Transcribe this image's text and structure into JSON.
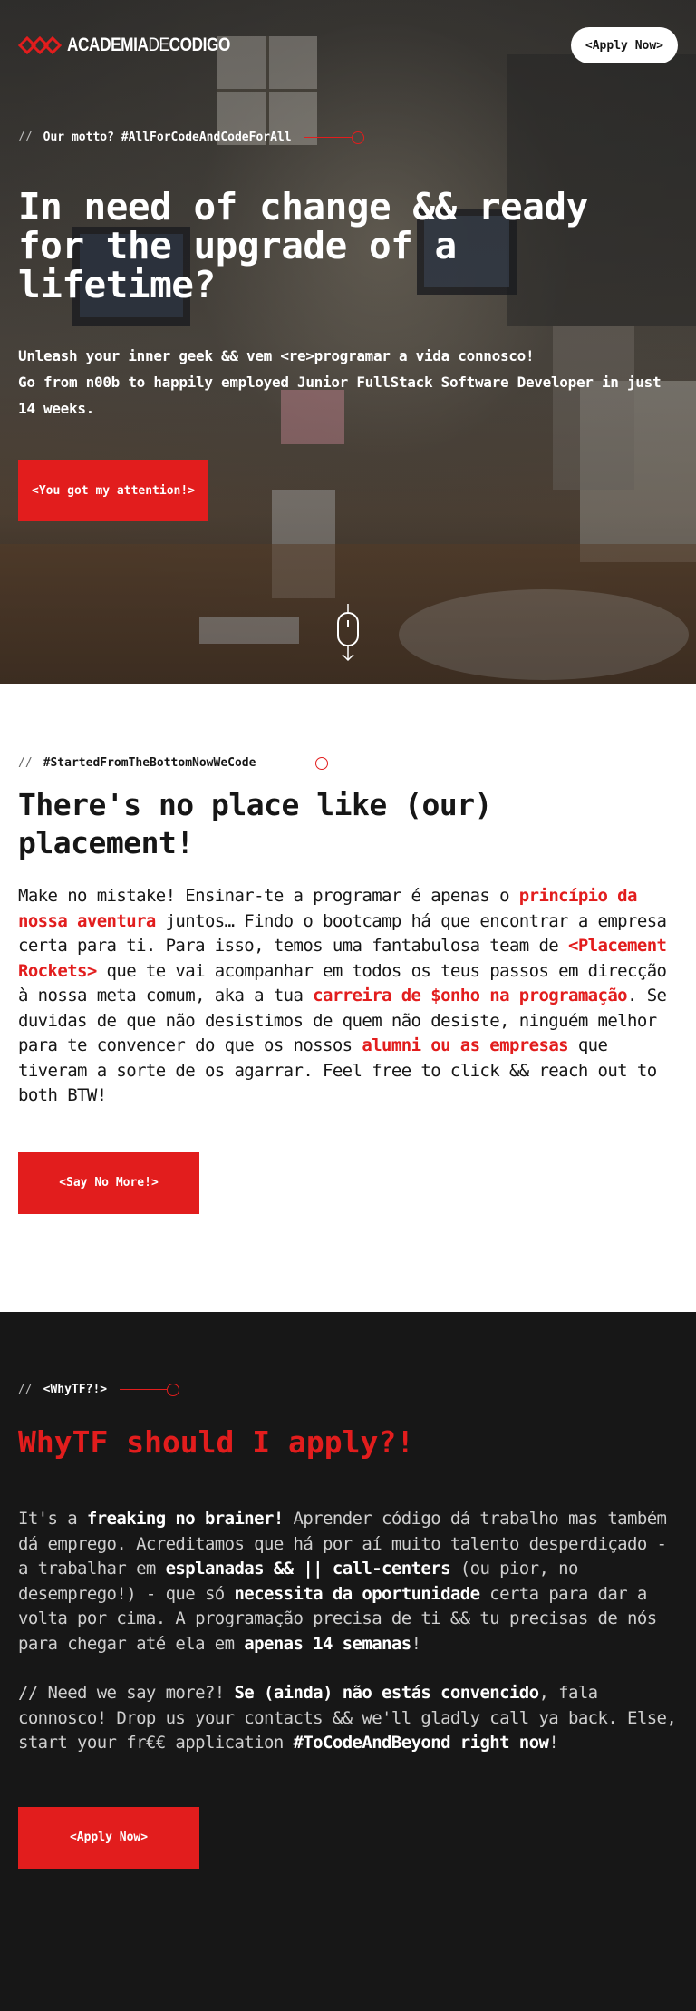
{
  "header": {
    "logo": {
      "brand_bold_1": "ACADEMIA",
      "brand_thin": "DE",
      "brand_bold_2": "CODIGO"
    },
    "apply_label": "<Apply Now>"
  },
  "hero": {
    "tagline_slashes": "//",
    "tagline": "Our motto? #AllForCodeAndCodeForAll",
    "title": "In need of change && ready for the upgrade of a lifetime?",
    "lead_line_1": "Unleash your inner geek && vem <re>programar a vida connosco!",
    "lead_line_2": "Go from n00b to happily employed Junior FullStack Software Developer in just 14 weeks.",
    "cta_label": "<You got my attention!>"
  },
  "placement": {
    "tagline_slashes": "//",
    "tagline": "#StartedFromTheBottomNowWeCode",
    "title": "There's no place like (our) placement!",
    "body": {
      "t1": "Make no mistake! Ensinar-te a programar é apenas o ",
      "h1": "princípio da nossa aventura",
      "t2": " juntos… Findo o bootcamp há que encontrar a empresa certa para ti. Para isso, temos uma fantabulosa team de ",
      "h2": "<Placement Rockets>",
      "t3": " que te vai acompanhar em todos os teus passos em direcção à nossa meta comum, aka a tua ",
      "h3": "carreira de $onho na programação",
      "t4": ". Se duvidas de que não desistimos de quem não desiste, ninguém melhor para te convencer do que os nossos ",
      "h4": "alumni ou as empresas",
      "t5": " que tiveram a sorte de os agarrar. Feel free to click && reach out to both BTW!"
    },
    "cta_label": "<Say No More!>"
  },
  "why": {
    "tagline_slashes": "//",
    "tagline": "<WhyTF?!>",
    "title": "WhyTF should I apply?!",
    "p1": {
      "t1": "It's a ",
      "b1": "freaking no brainer!",
      "t2": " Aprender código dá trabalho mas também dá emprego. Acreditamos que há por aí muito talento desperdiçado - a trabalhar em ",
      "b2": "esplanadas && || call-centers",
      "t3": " (ou pior, no desemprego!) - que só ",
      "b3": "necessita da oportunidade",
      "t4": " certa para dar a volta por cima. A programação precisa de ti && tu precisas de nós para chegar até ela em ",
      "b4": "apenas 14 semanas",
      "t5": "!"
    },
    "p2": {
      "t1": "// Need we say more?! ",
      "b1": "Se (ainda) não estás convencido",
      "t2": ", fala connosco! Drop us your contacts && we'll gladly call ya back. Else, start your fr€€ application ",
      "b2": "#ToCodeAndBeyond right now",
      "t3": "!"
    },
    "cta_label": "<Apply Now>"
  },
  "colors": {
    "accent": "#e21d1d",
    "dark_bg": "#171717",
    "text": "#161616"
  },
  "icons": [
    "logo-mark-icon",
    "scroll-mouse-icon",
    "tagline-dot-icon"
  ]
}
